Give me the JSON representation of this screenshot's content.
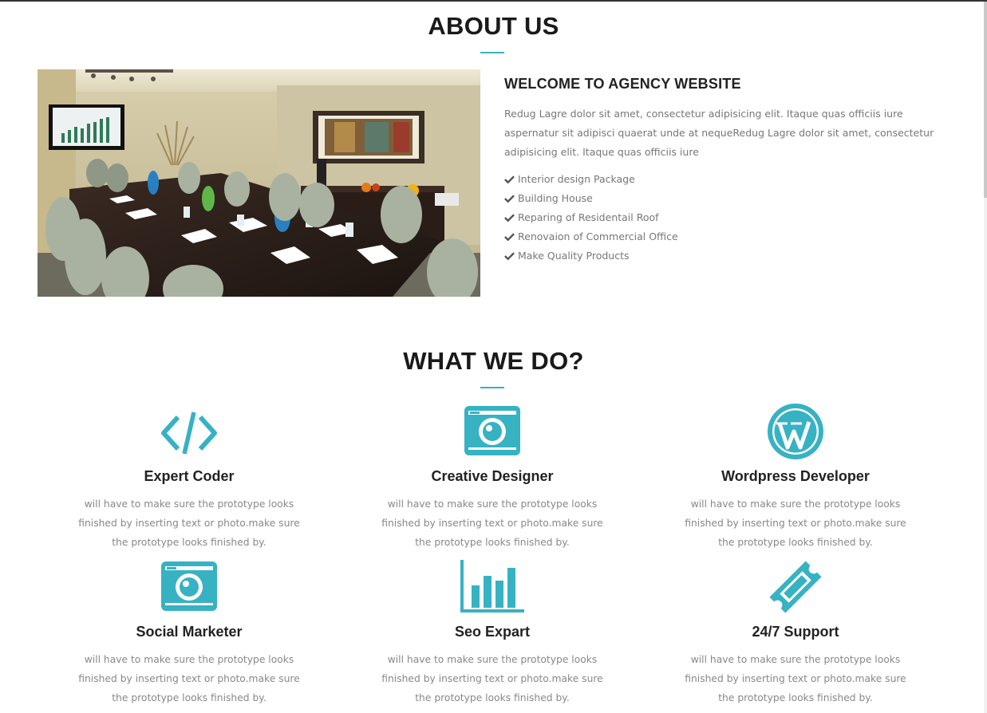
{
  "about": {
    "title": "ABOUT US",
    "heading": "WELCOME TO AGENCY WEBSITE",
    "paragraph": "Redug Lagre dolor sit amet, consectetur adipisicing elit. Itaque quas officiis iure aspernatur sit adipisci quaerat unde at nequeRedug Lagre dolor sit amet, consectetur adipisicing elit. Itaque quas officiis iure",
    "features": [
      "Interior design Package",
      "Building House",
      "Reparing of Residentail Roof",
      "Renovaion of Commercial Office",
      "Make Quality Products"
    ],
    "image_alt": "conference-room-photo"
  },
  "services": {
    "title": "WHAT WE DO?",
    "items": [
      {
        "icon": "code-icon",
        "name": "Expert Coder",
        "desc": "will have to make sure the prototype looks finished by inserting text or photo.make sure the prototype looks finished by."
      },
      {
        "icon": "camera-icon",
        "name": "Creative Designer",
        "desc": "will have to make sure the prototype looks finished by inserting text or photo.make sure the prototype looks finished by."
      },
      {
        "icon": "wordpress-icon",
        "name": "Wordpress Developer",
        "desc": "will have to make sure the prototype looks finished by inserting text or photo.make sure the prototype looks finished by."
      },
      {
        "icon": "camera-icon",
        "name": "Social Marketer",
        "desc": "will have to make sure the prototype looks finished by inserting text or photo.make sure the prototype looks finished by."
      },
      {
        "icon": "bar-chart-icon",
        "name": "Seo Expart",
        "desc": "will have to make sure the prototype looks finished by inserting text or photo.make sure the prototype looks finished by."
      },
      {
        "icon": "ticket-icon",
        "name": "24/7 Support",
        "desc": "will have to make sure the prototype looks finished by inserting text or photo.make sure the prototype looks finished by."
      }
    ]
  },
  "colors": {
    "accent": "#36b2c3",
    "heading": "#1a1a1a",
    "body_text": "#777777"
  }
}
